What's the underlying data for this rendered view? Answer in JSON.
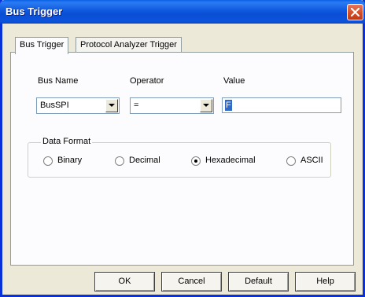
{
  "window": {
    "title": "Bus Trigger"
  },
  "tabs": [
    {
      "label": "Bus Trigger"
    },
    {
      "label": "Protocol Analyzer Trigger"
    }
  ],
  "fields": {
    "bus_name_label": "Bus Name",
    "operator_label": "Operator",
    "value_label": "Value",
    "bus_name_value": "BusSPI",
    "operator_value": "=",
    "value_value": "F"
  },
  "data_format": {
    "legend": "Data Format",
    "options": [
      {
        "label": "Binary",
        "selected": false
      },
      {
        "label": "Decimal",
        "selected": false
      },
      {
        "label": "Hexadecimal",
        "selected": true
      },
      {
        "label": "ASCII",
        "selected": false
      }
    ]
  },
  "buttons": {
    "ok": "OK",
    "cancel": "Cancel",
    "default": "Default",
    "help": "Help"
  },
  "colors": {
    "titlebar": "#0a4ed4",
    "close": "#d24a24",
    "selection": "#316ac5"
  },
  "icons": {
    "close": "close-icon",
    "dropdown": "chevron-down-icon"
  }
}
